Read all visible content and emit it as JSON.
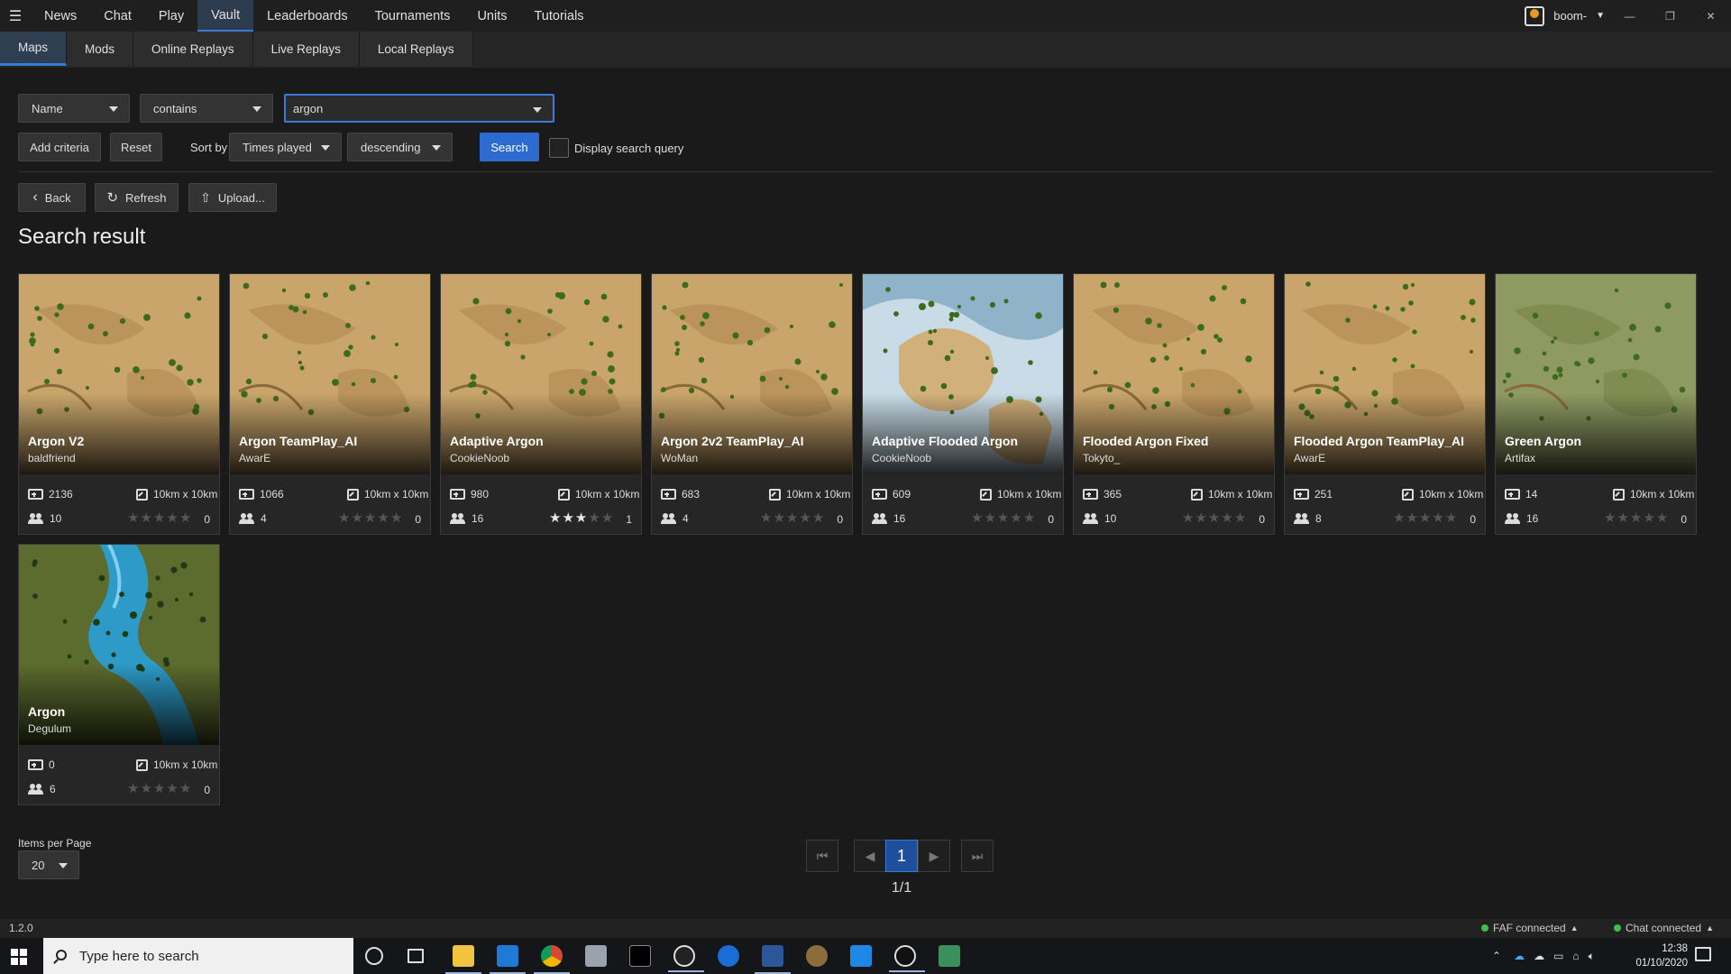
{
  "nav": {
    "items": [
      "News",
      "Chat",
      "Play",
      "Vault",
      "Leaderboards",
      "Tournaments",
      "Units",
      "Tutorials"
    ],
    "active": "Vault",
    "user": "boom-"
  },
  "subtabs": {
    "items": [
      "Maps",
      "Mods",
      "Online Replays",
      "Live Replays",
      "Local Replays"
    ],
    "active": "Maps"
  },
  "search": {
    "field": "Name",
    "operator": "contains",
    "query": "argon",
    "add_criteria": "Add criteria",
    "reset": "Reset",
    "sort_by_label": "Sort by",
    "sort_field": "Times played",
    "sort_order": "descending",
    "search_button": "Search",
    "display_query_label": "Display search query",
    "display_query_checked": false
  },
  "actions": {
    "back": "Back",
    "refresh": "Refresh",
    "upload": "Upload..."
  },
  "results_title": "Search result",
  "maps": [
    {
      "name": "Argon V2",
      "author": "baldfriend",
      "plays": "2136",
      "size": "10km x 10km",
      "players": "10",
      "rating": 0,
      "reviews": "0",
      "theme": "desert"
    },
    {
      "name": "Argon TeamPlay_AI",
      "author": "AwarE",
      "plays": "1066",
      "size": "10km x 10km",
      "players": "4",
      "rating": 0,
      "reviews": "0",
      "theme": "desert"
    },
    {
      "name": "Adaptive Argon",
      "author": "CookieNoob",
      "plays": "980",
      "size": "10km x 10km",
      "players": "16",
      "rating": 3,
      "reviews": "1",
      "theme": "desert"
    },
    {
      "name": "Argon 2v2 TeamPlay_AI",
      "author": "WoMan",
      "plays": "683",
      "size": "10km x 10km",
      "players": "4",
      "rating": 0,
      "reviews": "0",
      "theme": "desert"
    },
    {
      "name": "Adaptive Flooded Argon",
      "author": "CookieNoob",
      "plays": "609",
      "size": "10km x 10km",
      "players": "16",
      "rating": 0,
      "reviews": "0",
      "theme": "flooded"
    },
    {
      "name": "Flooded Argon Fixed",
      "author": "Tokyto_",
      "plays": "365",
      "size": "10km x 10km",
      "players": "10",
      "rating": 0,
      "reviews": "0",
      "theme": "desert"
    },
    {
      "name": "Flooded Argon TeamPlay_AI",
      "author": "AwarE",
      "plays": "251",
      "size": "10km x 10km",
      "players": "8",
      "rating": 0,
      "reviews": "0",
      "theme": "desert"
    },
    {
      "name": "Green Argon",
      "author": "Artifax",
      "plays": "14",
      "size": "10km x 10km",
      "players": "16",
      "rating": 0,
      "reviews": "0",
      "theme": "green"
    },
    {
      "name": "Argon",
      "author": "Degulum",
      "plays": "0",
      "size": "10km x 10km",
      "players": "6",
      "rating": 0,
      "reviews": "0",
      "theme": "river"
    }
  ],
  "pagination": {
    "items_per_page_label": "Items per Page",
    "items_per_page": "20",
    "current_page": "1",
    "page_info": "1/1"
  },
  "status": {
    "version": "1.2.0",
    "faf": "FAF connected",
    "chat": "Chat connected"
  },
  "taskbar": {
    "search_placeholder": "Type here to search",
    "time": "12:38",
    "date": "01/10/2020"
  },
  "colors": {
    "accent": "#3a7bd5",
    "primary_button": "#2e6bd0",
    "background": "#1a1a1a",
    "connected": "#3cc04a"
  }
}
